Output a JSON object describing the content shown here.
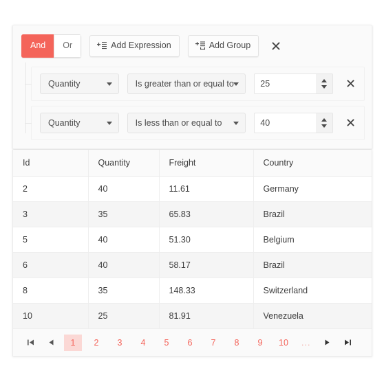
{
  "query_builder": {
    "logic": {
      "and_label": "And",
      "or_label": "Or",
      "active": "And"
    },
    "add_expression_label": "Add Expression",
    "add_group_label": "Add Group",
    "close_glyph": "✕",
    "accent_color": "#f4645a",
    "rules": [
      {
        "field": "Quantity",
        "operator": "Is greater than or equal to",
        "value": "25"
      },
      {
        "field": "Quantity",
        "operator": "Is less than or equal to",
        "value": "40"
      }
    ]
  },
  "grid": {
    "columns": [
      "Id",
      "Quantity",
      "Freight",
      "Country"
    ],
    "rows": [
      [
        "2",
        "40",
        "11.61",
        "Germany"
      ],
      [
        "3",
        "35",
        "65.83",
        "Brazil"
      ],
      [
        "5",
        "40",
        "51.30",
        "Belgium"
      ],
      [
        "6",
        "40",
        "58.17",
        "Brazil"
      ],
      [
        "8",
        "35",
        "148.33",
        "Switzerland"
      ],
      [
        "10",
        "25",
        "81.91",
        "Venezuela"
      ]
    ]
  },
  "pager": {
    "first_glyph": "⏮",
    "prev_glyph": "◀",
    "next_glyph": "▶",
    "last_glyph": "⏭",
    "pages": [
      "1",
      "2",
      "3",
      "4",
      "5",
      "6",
      "7",
      "8",
      "9",
      "10"
    ],
    "ellipsis": "...",
    "current_page": "1"
  }
}
